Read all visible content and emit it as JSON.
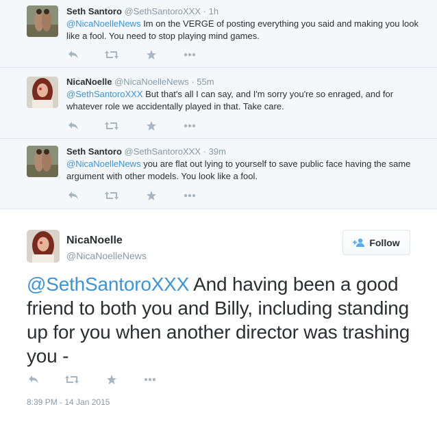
{
  "replies": [
    {
      "name": "Seth Santoro",
      "handle": "@SethSantoroXXX",
      "time": "1h",
      "mention": "@NicaNoelleNews",
      "text": " Im on the VERGE of posting everything you said and making you look like a fool. You need to stop playing mind games.",
      "avatar": "seth-avatar"
    },
    {
      "name": "NicaNoelle",
      "handle": "@NicaNoelleNews",
      "time": "55m",
      "mention": "@SethSantoroXXX",
      "text": " But that's all I can say, and I'm sorry you're so enraged, and for whatever role we accidentally played in that. Take care.",
      "avatar": "nica-avatar"
    },
    {
      "name": "Seth Santoro",
      "handle": "@SethSantoroXXX",
      "time": "39m",
      "mention": "@NicaNoelleNews",
      "text": " you are flat out lying to yourself to save public face having the same argument with other models. You look like a fool.",
      "avatar": "seth-avatar"
    }
  ],
  "separator": "·",
  "main_tweet": {
    "name": "NicaNoelle",
    "handle": "@NicaNoelleNews",
    "follow_label": "Follow",
    "mention": "@SethSantoroXXX",
    "text": " And having been a good friend to both you and Billy, including standing up for you when another director was trashing you -",
    "timestamp": "8:39 PM - 14 Jan 2015"
  },
  "colors": {
    "link": "#3b94d9",
    "muted": "#8899a6",
    "icon": "#a8b6c2",
    "reply_bg": "#f5f8fa"
  },
  "icons": [
    "reply-icon",
    "retweet-icon",
    "favorite-icon",
    "more-icon",
    "follow-user-icon"
  ]
}
